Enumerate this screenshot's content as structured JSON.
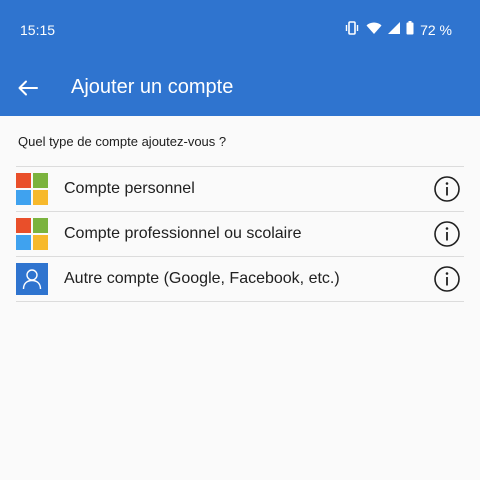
{
  "status": {
    "time": "15:15",
    "battery": "72 %",
    "icons": [
      "vibrate-icon",
      "wifi-icon",
      "signal-icon",
      "battery-icon"
    ]
  },
  "appbar": {
    "back_icon": "arrow-left-icon",
    "title": "Ajouter un compte"
  },
  "question": "Quel type de compte ajoutez-vous ?",
  "accounts": [
    {
      "label": "Compte personnel",
      "icon": "microsoft-logo-icon"
    },
    {
      "label": "Compte professionnel ou scolaire",
      "icon": "microsoft-logo-icon"
    },
    {
      "label": "Autre compte (Google, Facebook, etc.)",
      "icon": "user-icon"
    }
  ],
  "colors": {
    "accent": "#2f74cf",
    "ms_red": "#f25022",
    "ms_green": "#7fba00",
    "ms_blue": "#00a4ef",
    "ms_yellow": "#ffb900"
  }
}
